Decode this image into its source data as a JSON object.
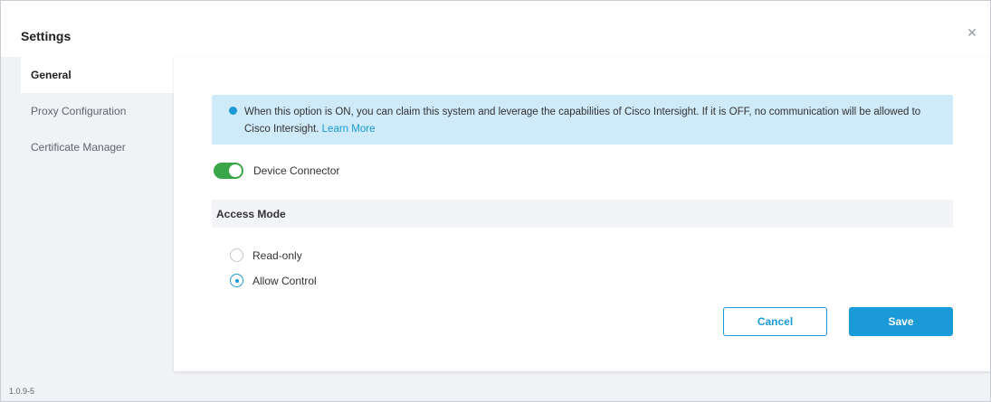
{
  "dialog": {
    "title": "Settings",
    "close_icon": "close-icon"
  },
  "sidebar": {
    "items": [
      {
        "label": "General",
        "active": true
      },
      {
        "label": "Proxy Configuration",
        "active": false
      },
      {
        "label": "Certificate Manager",
        "active": false
      }
    ]
  },
  "info": {
    "icon": "info-icon",
    "text": "When this option is ON, you can claim this system and leverage the capabilities of Cisco Intersight. If it is OFF, no communication will be allowed to Cisco Intersight.",
    "link": "Learn More",
    "color": "#cfeaf9"
  },
  "device_connector": {
    "label": "Device Connector",
    "enabled": true,
    "color": "#3aa64a"
  },
  "access_mode": {
    "title": "Access Mode",
    "options": [
      {
        "label": "Read-only",
        "selected": false
      },
      {
        "label": "Allow Control",
        "selected": true
      }
    ]
  },
  "actions": {
    "cancel": "Cancel",
    "save": "Save",
    "accent": "#1a9ad6"
  },
  "footer": {
    "version": "1.0.9-5"
  }
}
